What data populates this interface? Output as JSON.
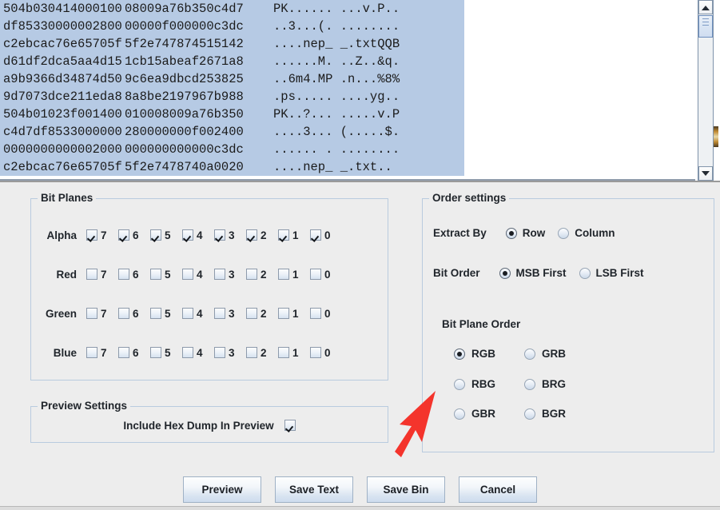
{
  "hex_dump": {
    "lines": [
      {
        "offset": "504b030414000100",
        "hex": "08009a76b350c4d7",
        "ascii": "PK...... ...v.P.."
      },
      {
        "offset": "df85330000002800",
        "hex": "00000f000000c3dc",
        "ascii": "..3...(. ........"
      },
      {
        "offset": "c2ebcac76e65705f",
        "hex": "5f2e747874515142",
        "ascii": "....nep_ _.txtQQB"
      },
      {
        "offset": "d61df2dca5aa4d15",
        "hex": "1cb15abeaf2671a8",
        "ascii": "......M. ..Z..&q."
      },
      {
        "offset": "a9b9366d34874d50",
        "hex": "9c6ea9dbcd253825",
        "ascii": "..6m4.MP .n...%8%"
      },
      {
        "offset": "9d7073dce211eda8",
        "hex": "8a8be2197967b988",
        "ascii": ".ps..... ....yg.."
      },
      {
        "offset": "504b01023f001400",
        "hex": "010008009a76b350",
        "ascii": "PK..?... .....v.P"
      },
      {
        "offset": "c4d7df8533000000",
        "hex": "280000000f002400",
        "ascii": "....3... (.....$."
      },
      {
        "offset": "0000000000002000",
        "hex": "000000000000c3dc",
        "ascii": "...... . ........"
      },
      {
        "offset": "c2ebcac76e65705f",
        "hex": "5f2e7478740a0020",
        "ascii": "....nep_ _.txt.."
      }
    ]
  },
  "scrollbar": {
    "up_arrow": "scroll-up-arrow",
    "down_arrow": "scroll-down-arrow"
  },
  "bit_planes": {
    "title": "Bit Planes",
    "bits": [
      "7",
      "6",
      "5",
      "4",
      "3",
      "2",
      "1",
      "0"
    ],
    "rows": [
      {
        "label": "Alpha",
        "checked": [
          true,
          true,
          true,
          true,
          true,
          true,
          true,
          true
        ]
      },
      {
        "label": "Red",
        "checked": [
          false,
          false,
          false,
          false,
          false,
          false,
          false,
          false
        ]
      },
      {
        "label": "Green",
        "checked": [
          false,
          false,
          false,
          false,
          false,
          false,
          false,
          false
        ]
      },
      {
        "label": "Blue",
        "checked": [
          false,
          false,
          false,
          false,
          false,
          false,
          false,
          false
        ]
      }
    ]
  },
  "preview_settings": {
    "title": "Preview Settings",
    "include_hex_dump_label": "Include Hex Dump In Preview",
    "include_hex_dump_checked": true
  },
  "order_settings": {
    "title": "Order settings",
    "extract_by": {
      "label": "Extract By",
      "options": [
        {
          "label": "Row",
          "selected": true
        },
        {
          "label": "Column",
          "selected": false
        }
      ]
    },
    "bit_order": {
      "label": "Bit Order",
      "options": [
        {
          "label": "MSB First",
          "selected": true
        },
        {
          "label": "LSB First",
          "selected": false
        }
      ]
    },
    "bit_plane_order": {
      "label": "Bit Plane Order",
      "options": [
        {
          "label": "RGB",
          "selected": true
        },
        {
          "label": "GRB",
          "selected": false
        },
        {
          "label": "RBG",
          "selected": false
        },
        {
          "label": "BRG",
          "selected": false
        },
        {
          "label": "GBR",
          "selected": false
        },
        {
          "label": "BGR",
          "selected": false
        }
      ]
    }
  },
  "buttons": [
    {
      "label": "Preview"
    },
    {
      "label": "Save Text"
    },
    {
      "label": "Save Bin"
    },
    {
      "label": "Cancel"
    }
  ],
  "annotation": {
    "arrow_color": "#f4342c",
    "points_to": "save-bin-button"
  },
  "colors": {
    "background": "#ededed",
    "selection_highlight": "#b6cae4",
    "panel_border": "#b9cbdf",
    "text": "#20252b"
  }
}
